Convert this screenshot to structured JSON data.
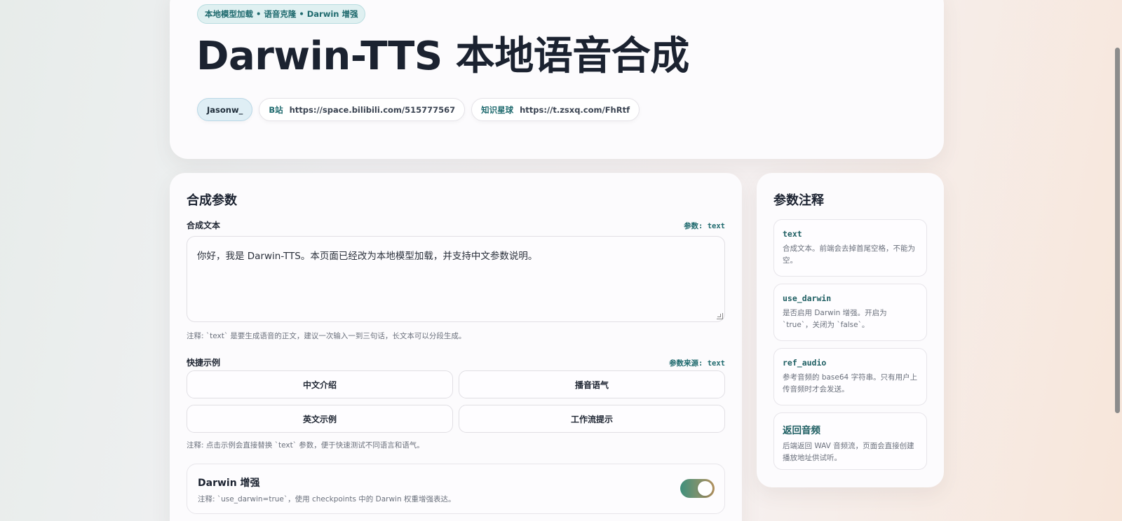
{
  "hero": {
    "badge": "本地模型加载 • 语音克隆 • Darwin 增强",
    "title": "Darwin-TTS 本地语音合成",
    "author": "Jasonw_",
    "bilibili_label": "B站",
    "bilibili_url": "https://space.bilibili.com/515777567",
    "zsxq_label": "知识星球",
    "zsxq_url": "https://t.zsxq.com/FhRtf"
  },
  "params": {
    "title": "合成参数",
    "text_label": "合成文本",
    "text_param": "参数: text",
    "text_value": "你好，我是 Darwin-TTS。本页面已经改为本地模型加载，并支持中文参数说明。",
    "text_note": "注释: `text` 是要生成语音的正文，建议一次输入一到三句话，长文本可以分段生成。",
    "examples_label": "快捷示例",
    "examples_param": "参数来源: text",
    "examples": [
      {
        "label": "中文介绍"
      },
      {
        "label": "播音语气"
      },
      {
        "label": "英文示例"
      },
      {
        "label": "工作流提示"
      }
    ],
    "examples_note": "注释: 点击示例会直接替换 `text` 参数，便于快速测试不同语言和语气。",
    "darwin_title": "Darwin 增强",
    "darwin_note": "注释: `use_darwin=true`，使用 checkpoints 中的 Darwin 权重增强表达。",
    "darwin_enabled": true
  },
  "notes": {
    "title": "参数注释",
    "items": [
      {
        "key": "text",
        "desc": "合成文本。前端会去掉首尾空格，不能为空。"
      },
      {
        "key": "use_darwin",
        "desc": "是否启用 Darwin 增强。开启为 `true`，关闭为 `false`。"
      },
      {
        "key": "ref_audio",
        "desc": "参考音频的 base64 字符串。只有用户上传音频时才会发送。"
      },
      {
        "key": "返回音频",
        "desc": "后端返回 WAV 音频流，页面会直接创建播放地址供试听。"
      }
    ]
  },
  "colors": {
    "accent": "#1f6a6e",
    "toggle_start": "#3e8f7c",
    "toggle_end": "#b79460"
  }
}
